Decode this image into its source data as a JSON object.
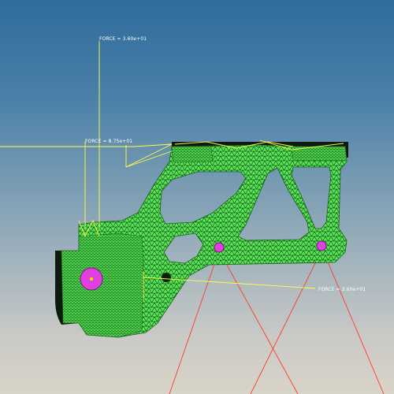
{
  "viewport": {
    "corner_text": "",
    "background_top": "#2f6b9c",
    "background_bottom": "#d9d4c9"
  },
  "model": {
    "mesh_color": "#55e655",
    "edge_color": "#0b2a0b",
    "constraint_color": "#e040e0",
    "force_color": "#ffff44",
    "support_line_color": "#ff3a2a"
  },
  "forces": [
    {
      "id": "top",
      "label": "FORCE = 3.60e+01"
    },
    {
      "id": "middle",
      "label": "FORCE = 8.75e+01"
    },
    {
      "id": "right",
      "label": "FORCE = 3.60e+01"
    }
  ]
}
